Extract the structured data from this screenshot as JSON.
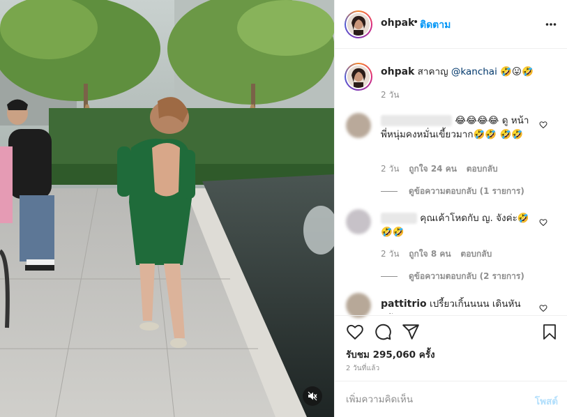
{
  "header": {
    "username": "ohpak",
    "dot": "•",
    "follow_label": "ติดตาม",
    "more_icon": "more-horizontal-icon"
  },
  "caption": {
    "username": "ohpak",
    "text": "สาคาญ",
    "mention": "@kanchai",
    "emojis": "🤣😛🤣",
    "time": "2 วัน"
  },
  "comments": [
    {
      "text_emojis": "😂😂😂😂",
      "text": "ดู หน้าพี่หนุ่มคงหมั่นเขี้ยวมาก🤣🤣 🤣🤣",
      "time": "2 วัน",
      "likes": "ถูกใจ 24 คน",
      "reply": "ตอบกลับ",
      "view_replies": "ดูข้อความตอบกลับ (1 รายการ)",
      "avatar_color": "#b9a99a"
    },
    {
      "text": "คุณเค้าโหดกับ ญ. จังค่ะ🤣 🤣🤣",
      "time": "2 วัน",
      "likes": "ถูกใจ 8 คน",
      "reply": "ตอบกลับ",
      "view_replies": "ดูข้อความตอบกลับ (2 รายการ)",
      "avatar_color": "#c7c2c8"
    },
    {
      "username": "pattitrio",
      "text": "เปรี้ยวเกิ้นนนน เดินหันหลัง",
      "avatar_color": "#b7a898"
    }
  ],
  "actions": {
    "like_icon": "heart-icon",
    "comment_icon": "comment-icon",
    "share_icon": "paper-plane-icon",
    "save_icon": "bookmark-icon",
    "views": "รับชม 295,060 ครั้ง",
    "ago": "2 วันที่แล้ว"
  },
  "add_comment": {
    "placeholder": "เพิ่มความคิดเห็น",
    "post_label": "โพสต์"
  },
  "media": {
    "mute_icon": "speaker-muted-icon"
  },
  "colors": {
    "accent": "#0095f6",
    "post_disabled": "#b2dffc",
    "muted_text": "#8e8e8e",
    "dress": "#1f6b3a"
  }
}
